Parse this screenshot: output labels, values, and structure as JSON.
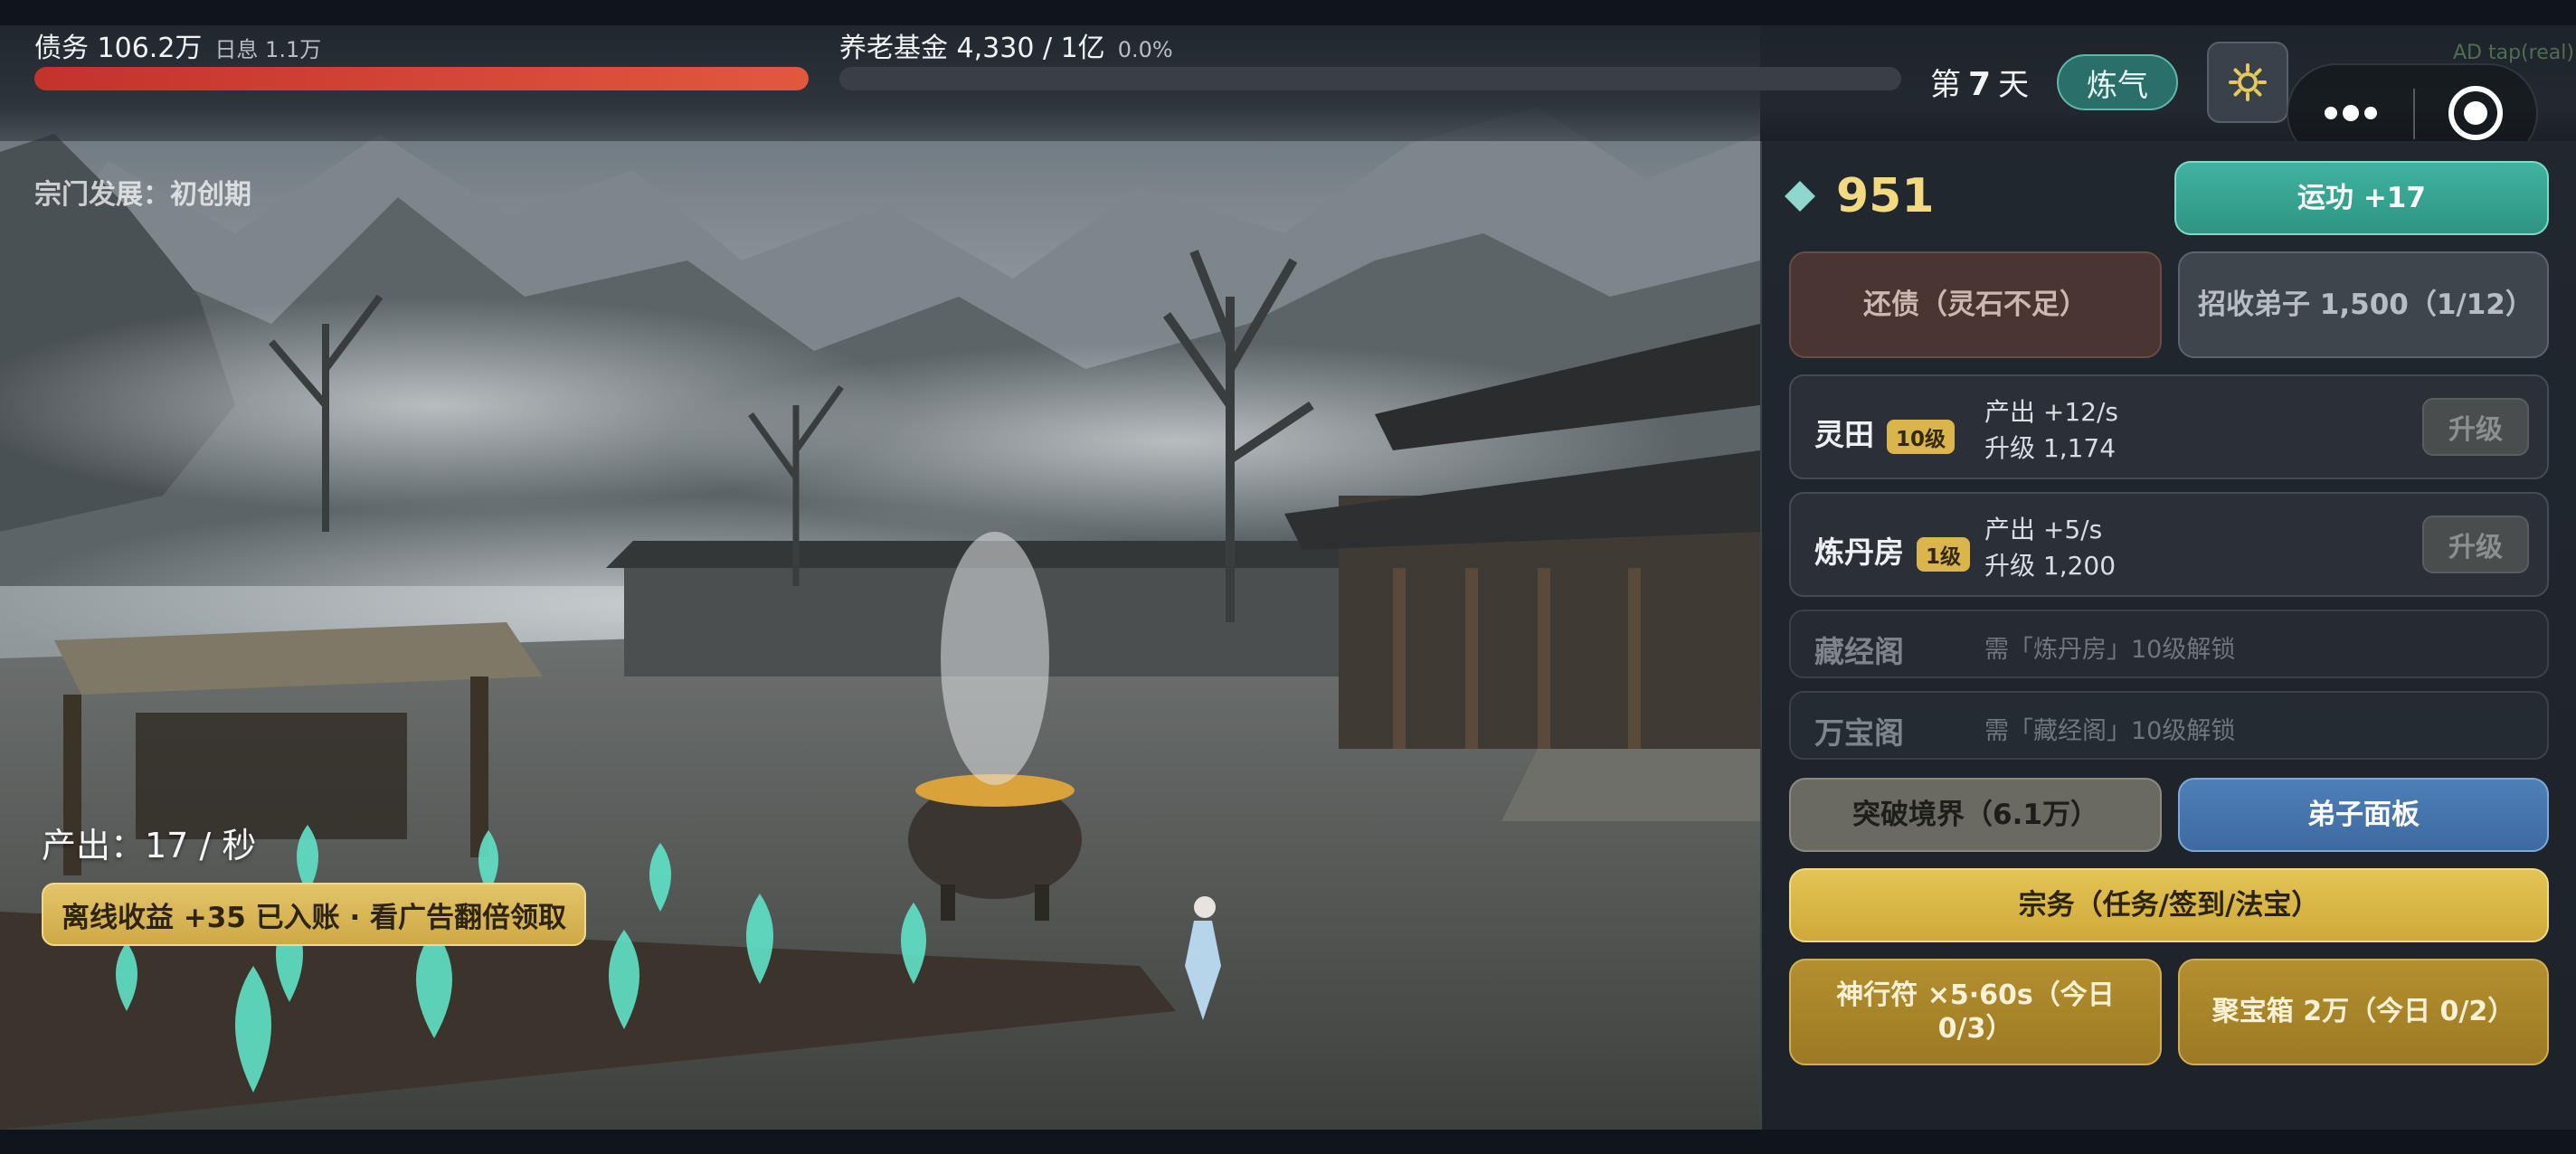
{
  "hud": {
    "debt_label": "债务 106.2万",
    "debt_interest": "日息 1.1万",
    "debt_progress": 1.0,
    "fund_label": "养老基金 4,330 / 1亿",
    "fund_percent": "0.0%",
    "fund_progress": 0.0,
    "day_prefix": "第",
    "day_number": "7",
    "day_suffix": "天",
    "realm": "炼气",
    "ad_tag": "AD tap(real)"
  },
  "scene": {
    "sect_stage": "宗门发展：初创期",
    "output_rate": "产出：17 / 秒",
    "offline_reward": "离线收益 +35 已入账 · 看广告翻倍领取"
  },
  "panel": {
    "spirit_stones": "951",
    "exercise_button": "运功 +17",
    "repay_button": "还债（灵石不足）",
    "recruit_button": "招收弟子 1,500（1/12）",
    "buildings": [
      {
        "name": "灵田",
        "level": "10级",
        "output": "产出 +12/s",
        "upgrade_cost": "升级 1,174",
        "upgrade_label": "升级"
      },
      {
        "name": "炼丹房",
        "level": "1级",
        "output": "产出 +5/s",
        "upgrade_cost": "升级 1,200",
        "upgrade_label": "升级"
      },
      {
        "name": "藏经阁",
        "hint": "需「炼丹房」10级解锁"
      },
      {
        "name": "万宝阁",
        "hint": "需「藏经阁」10级解锁"
      }
    ],
    "breakthrough_button": "突破境界（6.1万）",
    "disciples_button": "弟子面板",
    "sect_affairs_button": "宗务（任务/签到/法宝）",
    "talisman_button": "神行符 ×5·60s（今日 0/3）",
    "treasure_button": "聚宝箱 2万（今日 0/2）"
  },
  "colors": {
    "debt_bar": "#d63d33",
    "fund_bar": "#4fb7a4",
    "realm_badge": "#2b6f6a",
    "exercise_button": "#3fb3a0",
    "gold_button": "#d9b54b",
    "disciples_button": "#4f7fb8",
    "spirit_stone_value": "#f3d97f"
  },
  "icons": {
    "settings": "gear-icon",
    "more": "more-dots-icon",
    "close": "target-close-icon",
    "stone": "diamond-gem-icon"
  }
}
